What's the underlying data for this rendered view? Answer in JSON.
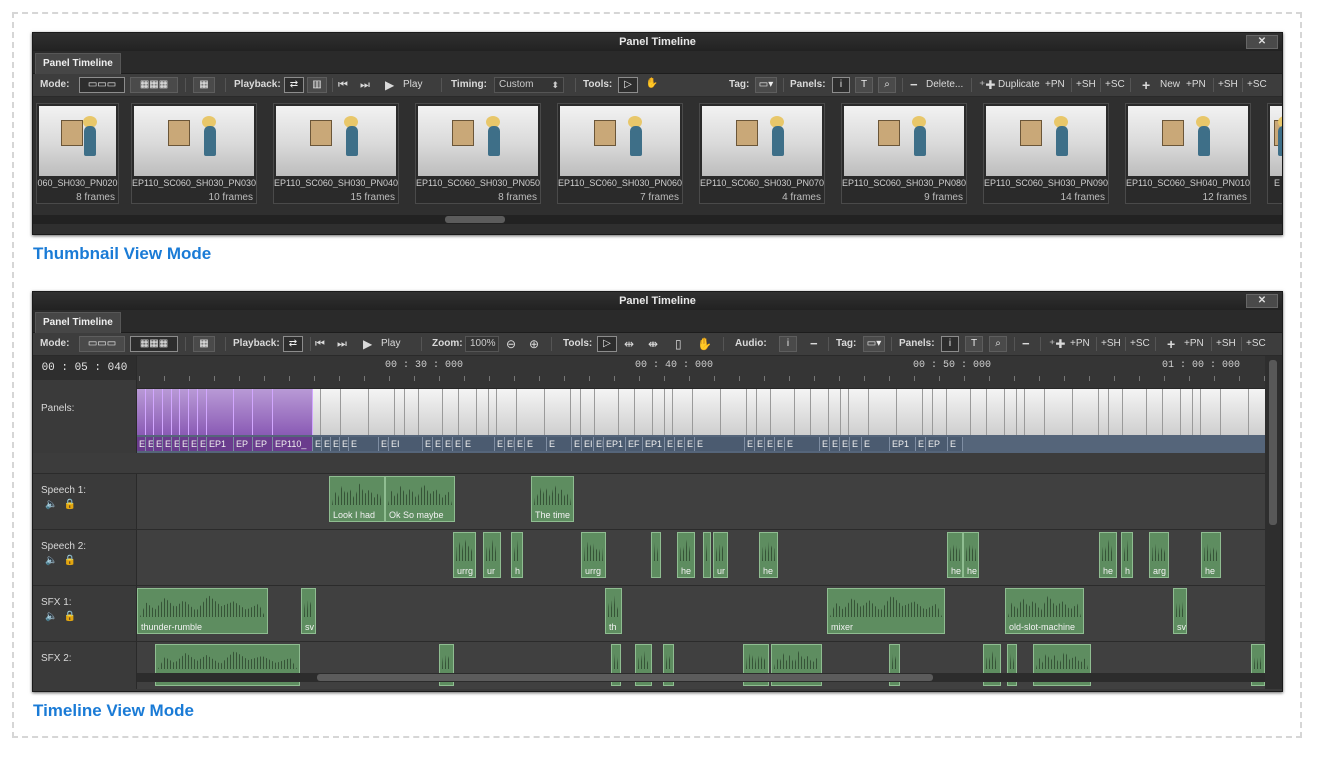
{
  "thumb_window": {
    "title": "Panel Timeline",
    "close": "✕",
    "tab": "Panel Timeline",
    "toolbar": {
      "mode_label": "Mode:",
      "playback_label": "Playback:",
      "play": "Play",
      "timing_label": "Timing:",
      "timing_value": "Custom",
      "tools_label": "Tools:",
      "tag_label": "Tag:",
      "panels_label": "Panels:",
      "delete": "Delete...",
      "duplicate": "Duplicate",
      "dup_pn": "+PN",
      "dup_sh": "+SH",
      "dup_sc": "+SC",
      "new": "New",
      "new_pn": "+PN",
      "new_sh": "+SH",
      "new_sc": "+SC"
    },
    "thumbnails": [
      {
        "name": "060_SH030_PN020",
        "frames": "8 frames"
      },
      {
        "name": "EP110_SC060_SH030_PN030",
        "frames": "10 frames"
      },
      {
        "name": "EP110_SC060_SH030_PN040",
        "frames": "15 frames"
      },
      {
        "name": "EP110_SC060_SH030_PN050",
        "frames": "8 frames"
      },
      {
        "name": "EP110_SC060_SH030_PN060",
        "frames": "7 frames"
      },
      {
        "name": "EP110_SC060_SH030_PN070",
        "frames": "4 frames"
      },
      {
        "name": "EP110_SC060_SH030_PN080",
        "frames": "9 frames"
      },
      {
        "name": "EP110_SC060_SH030_PN090",
        "frames": "14 frames"
      },
      {
        "name": "EP110_SC060_SH040_PN010",
        "frames": "12 frames"
      },
      {
        "name": "E",
        "frames": ""
      }
    ]
  },
  "caption1": "Thumbnail View Mode",
  "timeline_window": {
    "title": "Panel Timeline",
    "close": "✕",
    "tab": "Panel Timeline",
    "toolbar": {
      "mode_label": "Mode:",
      "playback_label": "Playback:",
      "play": "Play",
      "zoom_label": "Zoom:",
      "zoom_value": "100%",
      "tools_label": "Tools:",
      "audio_label": "Audio:",
      "tag_label": "Tag:",
      "panels_label": "Panels:",
      "dup_pn": "+PN",
      "dup_sh": "+SH",
      "dup_sc": "+SC",
      "new_pn": "+PN",
      "new_sh": "+SH",
      "new_sc": "+SC"
    },
    "timecode": "00 : 05 : 040",
    "ruler": [
      "00 : 30 : 000",
      "00 : 40 : 000",
      "00 : 50 : 000",
      "01 : 00 : 000"
    ],
    "tracks": {
      "panels": "Panels:",
      "speech1": "Speech 1:",
      "speech2": "Speech 2:",
      "sfx1": "SFX 1:",
      "sfx2": "SFX 2:"
    },
    "panel_labels": [
      "E",
      "E",
      "E",
      "E",
      "E",
      "E",
      "E",
      "E",
      "EP1",
      "EP",
      "EP",
      "EP110_",
      "E",
      "E",
      "E",
      "E",
      "E",
      "EI",
      "EI",
      "E",
      "E",
      "EI",
      "E",
      "E",
      "E",
      "EI",
      "E",
      "E",
      "E",
      "E",
      "EI",
      "EI",
      "EP1",
      "EF",
      "EP1",
      "E",
      "E",
      "E",
      "E",
      "E",
      "E",
      "E",
      "E",
      "E",
      "E",
      "E",
      "EI",
      "E",
      "E",
      "EP1",
      "E",
      "EP",
      "E"
    ],
    "clips": {
      "speech1": [
        "Look I had",
        "Ok So maybe",
        "The time"
      ],
      "speech2": [
        "urrg",
        "ur",
        "h",
        "urrg",
        "",
        "he",
        "",
        "ur",
        "he",
        "he",
        "he",
        "he",
        "h",
        "arg",
        "he"
      ],
      "sfx1": [
        "thunder-rumble",
        "sv",
        "th",
        "mixer",
        "old-slot-machine",
        "sv"
      ],
      "sfx2": [
        "",
        "",
        "",
        "",
        "",
        "",
        "",
        "",
        "",
        "",
        "",
        "",
        "",
        "",
        ""
      ]
    }
  },
  "caption2": "Timeline View Mode"
}
